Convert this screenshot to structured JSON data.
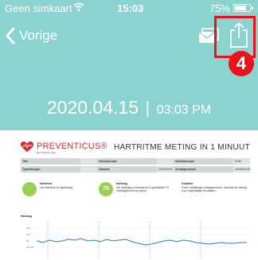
{
  "status_bar": {
    "carrier": "Geen simkaart",
    "time": "15:03",
    "battery_pct": "75%",
    "icons": [
      "wifi-icon",
      "battery-icon"
    ]
  },
  "nav": {
    "back_label": "Vorige",
    "icons": [
      "chevron-left-icon",
      "mail-icon",
      "share-icon"
    ]
  },
  "annotation": {
    "step_number": "4",
    "color": "#e8131c"
  },
  "measurement": {
    "date": "2020.04.15",
    "separator": "|",
    "time": "03:03 PM"
  },
  "report": {
    "logo_text": "PREVENTICUS®",
    "logo_sub": "RHYTHM IS LIFE",
    "title": "HARTRITME METING IN 1 MINUUT",
    "rows": [
      [
        {
          "label": "Titel",
          "value": ""
        },
        {
          "label": "Gestuurd aan",
          "value": ""
        },
        {
          "label": "Gebruikerspin",
          "value": "9765"
        }
      ],
      [
        {
          "label": "Opmerkingen",
          "value": ""
        },
        {
          "label": "Opname",
          "value": "2020/04/15 15:03"
        },
        {
          "label": "Verslagnummer",
          "value": "4009403-0002764"
        }
      ]
    ],
    "results": {
      "rhythm_label": "Hartritme",
      "rhythm_text": "Uw hartritme is regelmatig.",
      "heart_rate_value": "70",
      "heart_rate_label": "Hartslag",
      "heart_rate_text": "Uw hartslag is normaal en is gemiddeld 70 hartslagen/minuut (bpm).",
      "quality_label": "Kwaliteit",
      "quality_text": "Goed. afwijkingen waargenomen. Herhaal de meting voor regelmatige resultaten."
    },
    "chart_title": "Hartslag",
    "chart_y_labels": [
      "120",
      "100",
      "80",
      "60 bpm"
    ]
  },
  "colors": {
    "app_background": "#8ad3cf",
    "brand_red": "#d52b33",
    "good_green": "#9bcf55",
    "ecg_line": "#2f7fb3"
  }
}
